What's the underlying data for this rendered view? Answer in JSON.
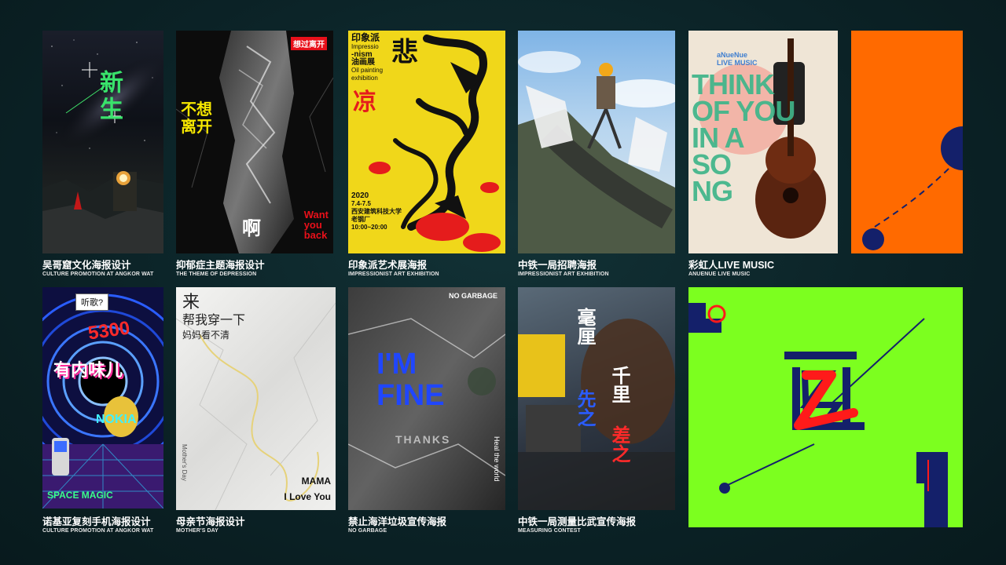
{
  "posters": [
    {
      "id": "angkor",
      "title": "吴哥窟文化海报设计",
      "subtitle": "CULTURE PROMOTION AT ANGKOR WAT",
      "art": {
        "headline": "新生"
      }
    },
    {
      "id": "depression",
      "title": "抑郁症主题海报设计",
      "subtitle": "THE THEME OF DEPRESSION",
      "art": {
        "headline": "不想离开",
        "tag": "想过离开",
        "en": [
          "Want",
          "you",
          "back"
        ],
        "bottom": "啊"
      }
    },
    {
      "id": "impressionism",
      "title": "印象派艺术展海报",
      "subtitle": "IMPRESSIONIST ART EXHIBITION",
      "art": {
        "cn_title": "印象派",
        "en_lines": [
          "Impressio",
          "-nism",
          "油画展",
          "Oil painting",
          "exhibition"
        ],
        "year": "2020",
        "dates": "7.4-7.5",
        "venue": [
          "西安建筑科技大学",
          "老钢厂"
        ],
        "time": "10:00~20:00",
        "big": "悲",
        "big2": "凉"
      }
    },
    {
      "id": "railway",
      "title": "中铁一局招聘海报",
      "subtitle": "IMPRESSIONIST ART EXHIBITION"
    },
    {
      "id": "anuenue",
      "title": "彩虹人LIVE MUSIC",
      "subtitle": "ANUENUE LIVE MUSIC",
      "art": {
        "brand": "aNueNue",
        "band": "LIVE MUSIC",
        "lines": [
          "THINK",
          "OF YOU",
          "IN A",
          "SO",
          "NG"
        ]
      }
    },
    {
      "id": "nokia",
      "title": "诺基亚复刻手机海报设计",
      "subtitle": "CULTURE PROMOTION AT ANGKOR WAT",
      "art": {
        "bubble": "听歌?",
        "num": "5300",
        "slogan": "有内味儿",
        "logo": "NOKIA",
        "foot": "SPACE MAGIC"
      }
    },
    {
      "id": "mothers",
      "title": "母亲节海报设计",
      "subtitle": "MOTHER'S DAY",
      "art": {
        "l1": "来",
        "l2": "帮我穿一下",
        "l3": "妈妈看不清",
        "side": "Mother's Day",
        "mama": "MAMA",
        "love": "I Love You"
      }
    },
    {
      "id": "garbage",
      "title": "禁止海洋垃圾宣传海报",
      "subtitle": "NO GARBAGE",
      "art": {
        "top": "NO GARBAGE",
        "big1": "I'M",
        "big2": "FINE",
        "small": "THANKS",
        "side": "Heal the world"
      }
    },
    {
      "id": "measuring",
      "title": "中铁一局测量比武宣传海报",
      "subtitle": "MEASURING CONTEST",
      "art": {
        "col1": "毫厘",
        "col2": "先之",
        "col3": "千里",
        "col4": "差之"
      }
    }
  ],
  "colors": {
    "bg": "#0b2226",
    "lime": "#7cff1f",
    "orange": "#ff6a00",
    "navy": "#14206a",
    "red": "#ff1a1a"
  }
}
